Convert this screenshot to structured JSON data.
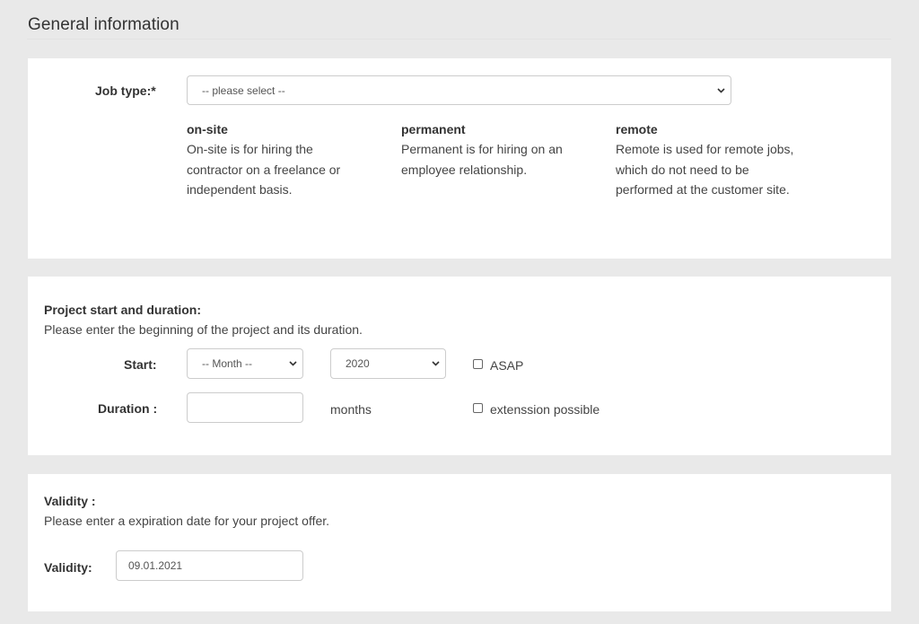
{
  "page": {
    "title": "General information"
  },
  "job_type": {
    "label": "Job type:*",
    "select_value": "-- please select --",
    "options": [
      {
        "title": "on-site",
        "description": "On-site is for hiring the contractor on a freelance or independent basis."
      },
      {
        "title": "permanent",
        "description": "Permanent is for hiring on an employee relationship."
      },
      {
        "title": "remote",
        "description": "Remote is used for remote jobs, which do not need to be performed at the customer site."
      }
    ]
  },
  "project": {
    "heading": "Project start and duration:",
    "help": "Please enter the beginning of the project and its duration.",
    "start_label": "Start:",
    "month_value": "-- Month --",
    "year_value": "2020",
    "asap_label": "ASAP",
    "asap_checked": false,
    "duration_label": "Duration :",
    "duration_value": "",
    "duration_unit": "months",
    "extension_label": "extenssion possible",
    "extension_checked": false
  },
  "validity": {
    "heading": "Validity :",
    "help": "Please enter a expiration date for your project offer.",
    "label": "Validity:",
    "value": "09.01.2021"
  },
  "icons": {
    "select_caret": "chevron-down"
  }
}
